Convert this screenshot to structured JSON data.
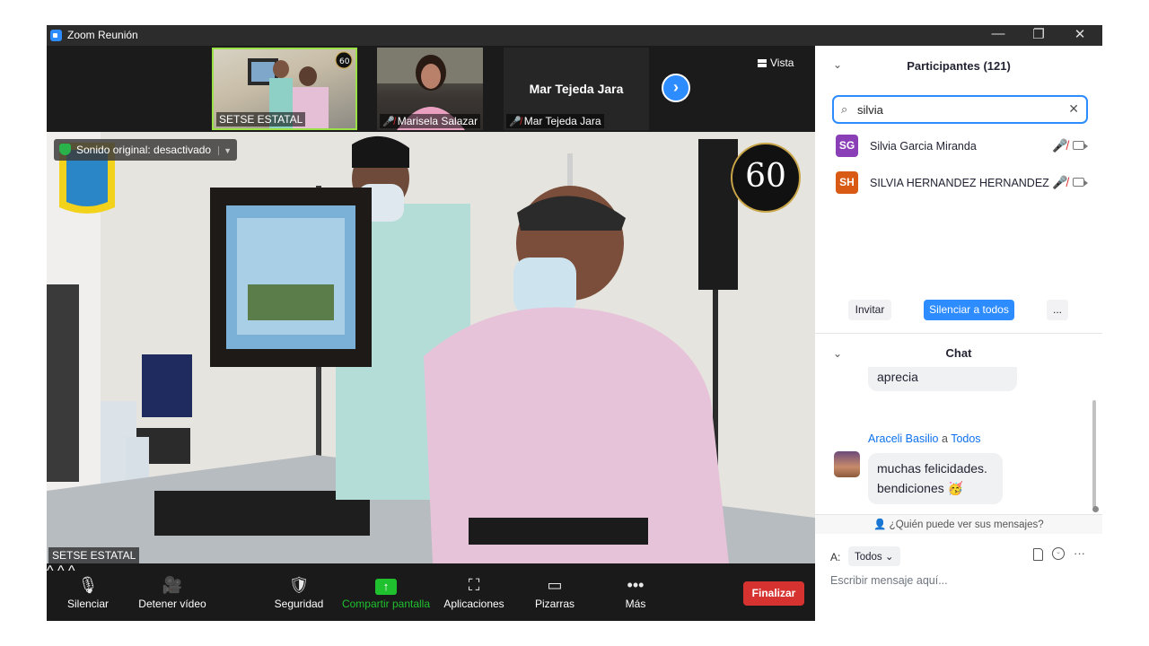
{
  "window": {
    "title": "Zoom Reunión",
    "controls": {
      "minimize": "—",
      "restore": "❐",
      "close": "✕"
    }
  },
  "filmstrip": {
    "thumbs": [
      {
        "label": "SETSE ESTATAL",
        "muted": false
      },
      {
        "label": "Marisela Salazar",
        "muted": true
      },
      {
        "label": "Mar Tejeda Jara",
        "muted": true,
        "display_name": "Mar Tejeda Jara"
      }
    ],
    "next_icon": "›",
    "view_label": "Vista"
  },
  "main_video": {
    "sound_badge": "Sonido original: desactivado",
    "participant_label": "SETSE ESTATAL",
    "logo_text": "60"
  },
  "toolbar": {
    "mute_label": "Silenciar",
    "video_label": "Detener vídeo",
    "security_label": "Seguridad",
    "share_label": "Compartir pantalla",
    "apps_label": "Aplicaciones",
    "whiteboards_label": "Pizarras",
    "more_label": "Más",
    "end_label": "Finalizar",
    "share_color": "#20c12f",
    "end_color": "#d6322f"
  },
  "participants": {
    "title": "Participantes (121)",
    "search_value": "silvia",
    "list": [
      {
        "initials": "SG",
        "name": "Silvia Garcia Miranda",
        "color": "#8a3fb7"
      },
      {
        "initials": "SH",
        "name": "SILVIA HERNANDEZ HERNANDEZ",
        "color": "#d85a14"
      }
    ],
    "invite_label": "Invitar",
    "mute_all_label": "Silenciar a todos",
    "more_label": "..."
  },
  "chat": {
    "title": "Chat",
    "partial_message": "aprecia",
    "sender": "Araceli Basilio",
    "connector": "a",
    "recipient": "Todos",
    "message_line1": "muchas felicidades.",
    "message_line2": "bendiciones 🥳",
    "who_sees": "¿Quién puede ver sus mensajes?",
    "to_prefix": "A:",
    "to_value": "Todos",
    "input_placeholder": "Escribir mensaje aquí..."
  },
  "accent_color": "#2d8cff"
}
